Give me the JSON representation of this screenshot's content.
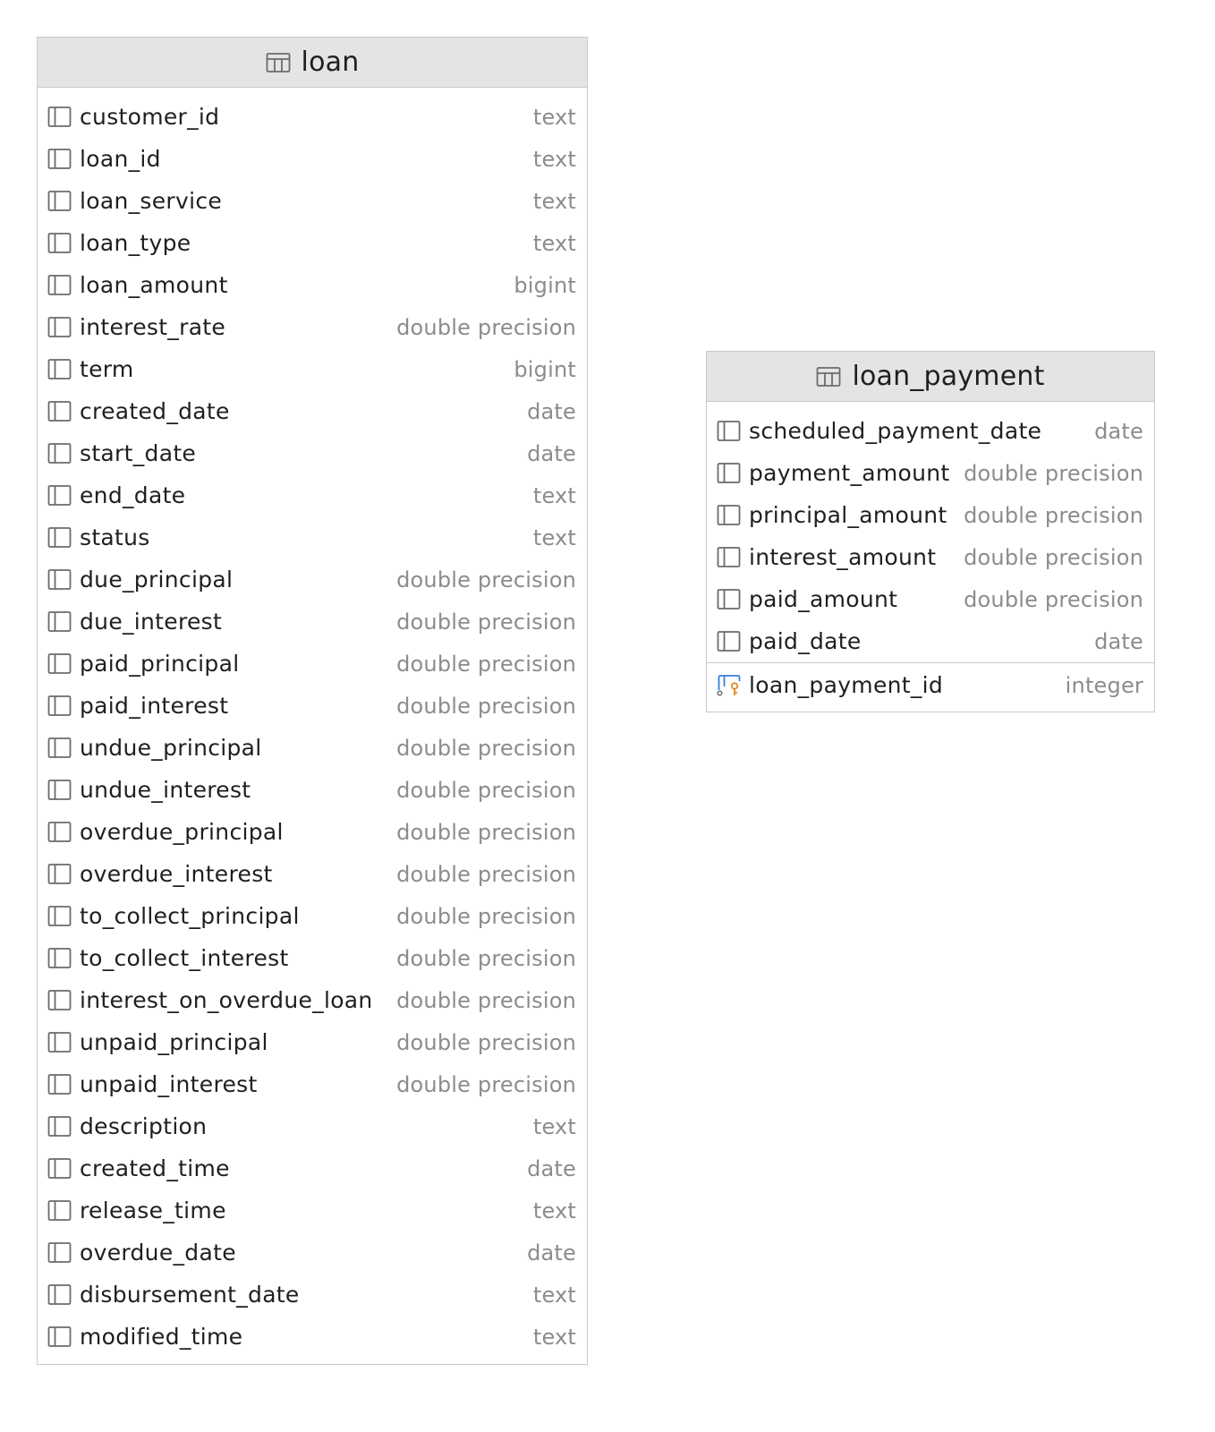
{
  "tables": {
    "loan": {
      "title": "loan",
      "columns": [
        {
          "name": "customer_id",
          "type": "text"
        },
        {
          "name": "loan_id",
          "type": "text"
        },
        {
          "name": "loan_service",
          "type": "text"
        },
        {
          "name": "loan_type",
          "type": "text"
        },
        {
          "name": "loan_amount",
          "type": "bigint"
        },
        {
          "name": "interest_rate",
          "type": "double precision"
        },
        {
          "name": "term",
          "type": "bigint"
        },
        {
          "name": "created_date",
          "type": "date"
        },
        {
          "name": "start_date",
          "type": "date"
        },
        {
          "name": "end_date",
          "type": "text"
        },
        {
          "name": "status",
          "type": "text"
        },
        {
          "name": "due_principal",
          "type": "double precision"
        },
        {
          "name": "due_interest",
          "type": "double precision"
        },
        {
          "name": "paid_principal",
          "type": "double precision"
        },
        {
          "name": "paid_interest",
          "type": "double precision"
        },
        {
          "name": "undue_principal",
          "type": "double precision"
        },
        {
          "name": "undue_interest",
          "type": "double precision"
        },
        {
          "name": "overdue_principal",
          "type": "double precision"
        },
        {
          "name": "overdue_interest",
          "type": "double precision"
        },
        {
          "name": "to_collect_principal",
          "type": "double precision"
        },
        {
          "name": "to_collect_interest",
          "type": "double precision"
        },
        {
          "name": "interest_on_overdue_loan",
          "type": "double precision"
        },
        {
          "name": "unpaid_principal",
          "type": "double precision"
        },
        {
          "name": "unpaid_interest",
          "type": "double precision"
        },
        {
          "name": "description",
          "type": "text"
        },
        {
          "name": "created_time",
          "type": "date"
        },
        {
          "name": "release_time",
          "type": "text"
        },
        {
          "name": "overdue_date",
          "type": "date"
        },
        {
          "name": "disbursement_date",
          "type": "text"
        },
        {
          "name": "modified_time",
          "type": "text"
        }
      ]
    },
    "loan_payment": {
      "title": "loan_payment",
      "columns": [
        {
          "name": "scheduled_payment_date",
          "type": "date"
        },
        {
          "name": "payment_amount",
          "type": "double precision"
        },
        {
          "name": "principal_amount",
          "type": "double precision"
        },
        {
          "name": "interest_amount",
          "type": "double precision"
        },
        {
          "name": "paid_amount",
          "type": "double precision"
        },
        {
          "name": "paid_date",
          "type": "date"
        }
      ],
      "key_columns": [
        {
          "name": "loan_payment_id",
          "type": "integer"
        }
      ]
    }
  },
  "icons": {
    "table": "table-icon",
    "column": "column-icon",
    "primary_key": "primary-key-column-icon"
  },
  "colors": {
    "header_bg": "#e4e4e4",
    "border": "#c9c9c9",
    "name_text": "#1f1f1f",
    "type_text": "#8c8c8c",
    "key_blue": "#3b7de0",
    "key_orange": "#e08a2c"
  }
}
